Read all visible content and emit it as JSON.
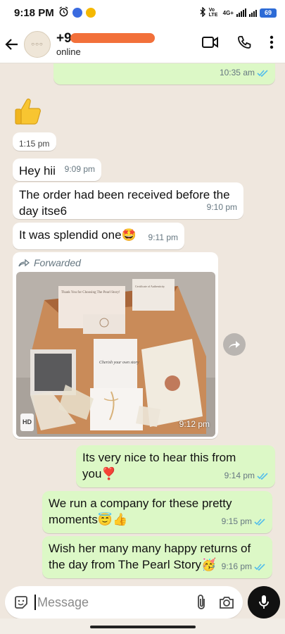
{
  "status_bar": {
    "time": "9:18 PM",
    "network_label": "4G+",
    "volte_label": "Vo LTE",
    "battery": "69"
  },
  "header": {
    "contact_number_visible": "+9",
    "contact_status": "online",
    "avatar_text": "○○○"
  },
  "colors": {
    "incoming_bubble": "#ffffff",
    "outgoing_bubble": "#dcf8c6",
    "read_ticks": "#53bdeb",
    "chat_background": "#efe7de"
  },
  "messages": [
    {
      "direction": "out",
      "text": "",
      "time": "10:35 am",
      "read": true
    },
    {
      "direction": "in",
      "type": "sticker",
      "sticker": "thumbs-up",
      "time": "1:15 pm"
    },
    {
      "direction": "in",
      "text": "Hey hii",
      "time": "9:09 pm"
    },
    {
      "direction": "in",
      "text": "The order had been received before the day itse6",
      "time": "9:10 pm"
    },
    {
      "direction": "in",
      "text": "It was splendid one🤩",
      "time": "9:11 pm"
    },
    {
      "direction": "in",
      "type": "image",
      "forwarded_label": "Forwarded",
      "badge": "HD",
      "time": "9:12 pm",
      "image_text": {
        "card_title": "Thank You for Choosing The Pearl Story!",
        "certificate": "Certificate of Authenticity",
        "note": "Cherish your own story"
      }
    },
    {
      "direction": "out",
      "text": "Its very nice to hear this from you❣️",
      "time": "9:14 pm",
      "read": true
    },
    {
      "direction": "out",
      "text": "We run a company for these pretty moments😇👍",
      "time": "9:15 pm",
      "read": true
    },
    {
      "direction": "out",
      "text": "Wish her many many happy returns of the day from The Pearl Story🥳",
      "time": "9:16 pm",
      "read": true
    }
  ],
  "input": {
    "placeholder": "Message"
  }
}
